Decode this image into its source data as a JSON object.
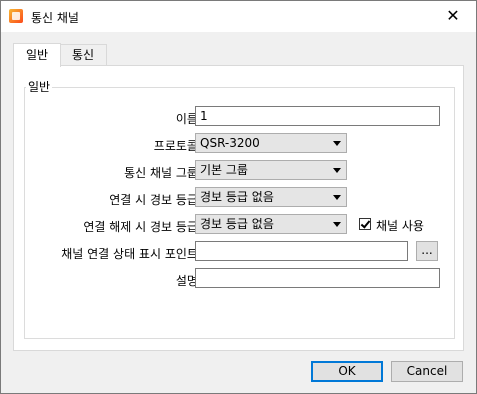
{
  "window": {
    "title": "통신 채널",
    "close_glyph": "✕",
    "app_icon": "app-icon"
  },
  "tabs": [
    {
      "label": "일반",
      "active": true
    },
    {
      "label": "통신",
      "active": false
    }
  ],
  "group": {
    "title": "일반"
  },
  "fields": {
    "name": {
      "label": "이름:",
      "value": "1"
    },
    "protocol": {
      "label": "프로토콜:",
      "value": "QSR-3200"
    },
    "channel_group": {
      "label": "통신 채널 그룹:",
      "value": "기본 그룹"
    },
    "connect_alarm": {
      "label": "연결 시 경보 등급:",
      "value": "경보 등급 없음"
    },
    "disconnect_alarm": {
      "label": "연결 해제 시 경보 등급:",
      "value": "경보 등급 없음"
    },
    "use_channel": {
      "label": "채널 사용",
      "checked": true
    },
    "status_point": {
      "label": "채널 연결 상태 표시 포인트:",
      "value": "",
      "browse_label": "..."
    },
    "description": {
      "label": "설명:",
      "value": ""
    }
  },
  "buttons": {
    "ok": "OK",
    "cancel": "Cancel"
  }
}
